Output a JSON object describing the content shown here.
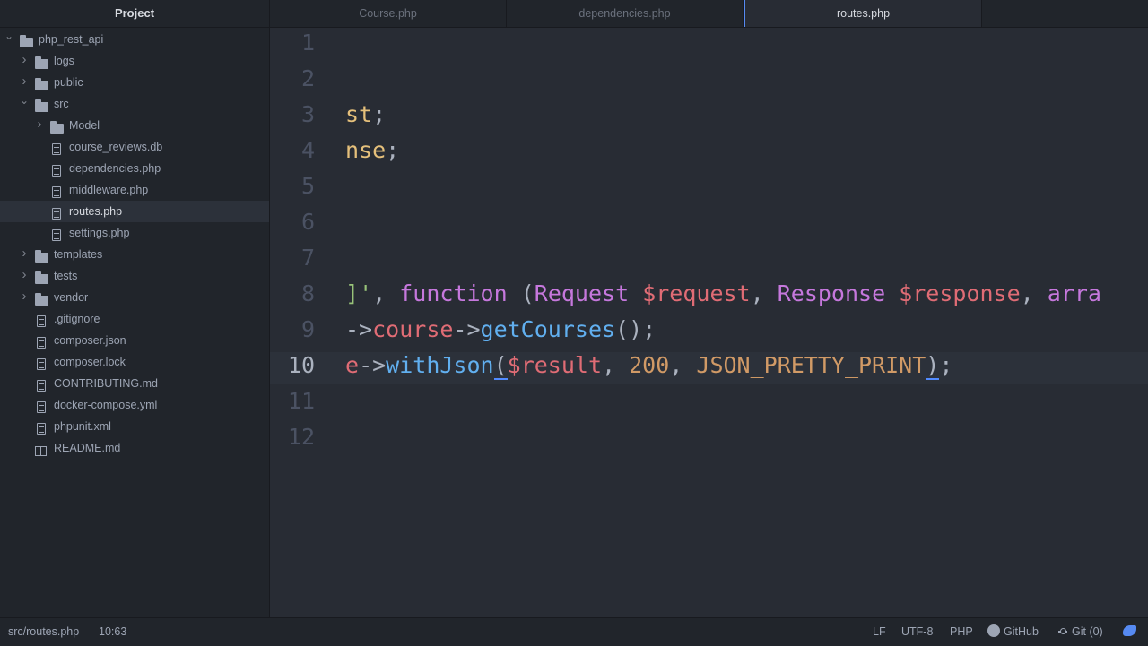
{
  "sidebar": {
    "title": "Project",
    "tree": [
      {
        "label": "php_rest_api",
        "type": "folder",
        "expanded": true,
        "depth": 0
      },
      {
        "label": "logs",
        "type": "folder",
        "expanded": false,
        "depth": 1
      },
      {
        "label": "public",
        "type": "folder",
        "expanded": false,
        "depth": 1
      },
      {
        "label": "src",
        "type": "folder",
        "expanded": true,
        "depth": 1
      },
      {
        "label": "Model",
        "type": "folder",
        "expanded": false,
        "depth": 2
      },
      {
        "label": "course_reviews.db",
        "type": "file",
        "depth": 2
      },
      {
        "label": "dependencies.php",
        "type": "file",
        "depth": 2
      },
      {
        "label": "middleware.php",
        "type": "file",
        "depth": 2
      },
      {
        "label": "routes.php",
        "type": "file",
        "depth": 2,
        "selected": true
      },
      {
        "label": "settings.php",
        "type": "file",
        "depth": 2
      },
      {
        "label": "templates",
        "type": "folder",
        "expanded": false,
        "depth": 1
      },
      {
        "label": "tests",
        "type": "folder",
        "expanded": false,
        "depth": 1
      },
      {
        "label": "vendor",
        "type": "folder",
        "expanded": false,
        "depth": 1
      },
      {
        "label": ".gitignore",
        "type": "file",
        "depth": 1
      },
      {
        "label": "composer.json",
        "type": "file",
        "depth": 1
      },
      {
        "label": "composer.lock",
        "type": "file",
        "depth": 1
      },
      {
        "label": "CONTRIBUTING.md",
        "type": "file",
        "depth": 1
      },
      {
        "label": "docker-compose.yml",
        "type": "file",
        "depth": 1
      },
      {
        "label": "phpunit.xml",
        "type": "file",
        "depth": 1
      },
      {
        "label": "README.md",
        "type": "book",
        "depth": 1
      }
    ]
  },
  "tabs": [
    {
      "label": "Course.php",
      "active": false
    },
    {
      "label": "dependencies.php",
      "active": false
    },
    {
      "label": "routes.php",
      "active": true
    }
  ],
  "editor": {
    "cursor_line": 10,
    "line_numbers": [
      "1",
      "2",
      "3",
      "4",
      "5",
      "6",
      "7",
      "8",
      "9",
      "10",
      "11",
      "12"
    ],
    "lines": {
      "l3": {
        "a": "st",
        "b": ";"
      },
      "l4": {
        "a": "nse",
        "b": ";"
      },
      "l8": {
        "a": "]",
        "b": "'",
        "c": ", ",
        "d": "function",
        "e": " (",
        "f": "Request",
        "g": " ",
        "h": "$request",
        "i": ", ",
        "j": "Response",
        "k": " ",
        "l": "$response",
        "m": ", ",
        "n": "arra"
      },
      "l9": {
        "a": "->",
        "b": "course",
        "c": "->",
        "d": "getCourses",
        "e": "();"
      },
      "l10": {
        "a": "e",
        "b": "->",
        "c": "withJson",
        "d": "(",
        "e": "$result",
        "f": ", ",
        "g": "200",
        "h": ", ",
        "i": "JSON_PRETTY_PRINT",
        "j": ")",
        "k": ";"
      }
    }
  },
  "status": {
    "path": "src/routes.php",
    "cursor": "10:63",
    "line_ending": "LF",
    "encoding": "UTF-8",
    "grammar": "PHP",
    "github": "GitHub",
    "git": "Git (0)",
    "icons": {
      "github": "github-icon",
      "git": "git-icon",
      "feedback": "bird-icon"
    }
  }
}
